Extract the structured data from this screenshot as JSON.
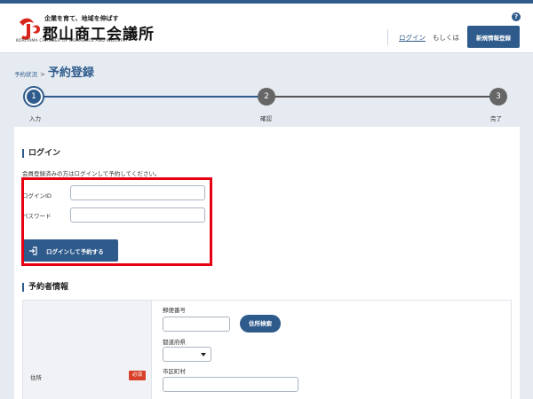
{
  "header": {
    "logo_slogan": "企業を育て、地域を伸ばす",
    "logo_name": "郡山商工会議所",
    "logo_english": "KORIYAMA CHAMBER OF COMMERCE AND INDUSTRY",
    "help_label": "?",
    "login_link": "ログイン",
    "or_text": "もしくは",
    "register_button": "新規情報登録"
  },
  "breadcrumb": {
    "prev": "予約状況",
    "separator": ">",
    "current": "予約登録"
  },
  "steps": [
    {
      "number": "1",
      "label": "入力",
      "active": true
    },
    {
      "number": "2",
      "label": "確認",
      "active": false
    },
    {
      "number": "3",
      "label": "完了",
      "active": false
    }
  ],
  "login_section": {
    "heading": "ログイン",
    "hint": "会員登録済みの方はログインして予約してください。",
    "id_label": "ログインID",
    "id_value": "",
    "password_label": "パスワード",
    "password_value": "",
    "submit_button": "ログインして予約する"
  },
  "reserver_section": {
    "heading": "予約者情報",
    "address_label": "住所",
    "required_badge": "必須",
    "postal_code_label": "郵便番号",
    "postal_code_value": "",
    "address_search_button": "住所検索",
    "prefecture_label": "都道府県",
    "prefecture_value": "",
    "city_label": "市区町村",
    "city_value": ""
  },
  "colors": {
    "brand": "#2f5b8c",
    "highlight": "#e60012",
    "required": "#d9402b",
    "page_background": "#e5ebf1"
  },
  "icons": {
    "logo": "logo-mark-icon",
    "help": "help-icon",
    "login": "login-arrow-icon",
    "dropdown": "chevron-down-icon"
  }
}
